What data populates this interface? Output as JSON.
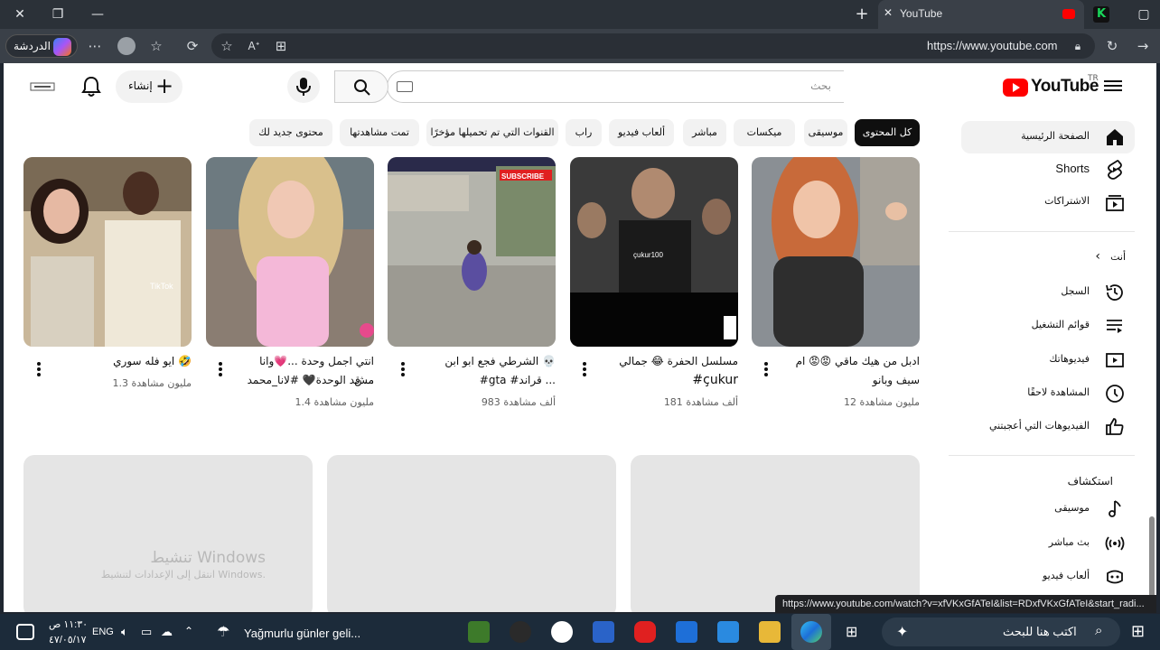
{
  "browser": {
    "tab_title": "YouTube",
    "url": "https://www.youtube.com",
    "chat_label": "الدردشة",
    "status_url": "https://www.youtube.com/watch?v=xfVKxGfATeI&list=RDxfVKxGfATeI&start_radi..."
  },
  "header": {
    "region": "TR",
    "logo_text": "YouTube",
    "search_placeholder": "بحث",
    "create_label": "إنشاء",
    "create_plus": "+"
  },
  "chips": [
    {
      "label": "كل المحتوى",
      "active": true
    },
    {
      "label": "موسيقى"
    },
    {
      "label": "ميكسات"
    },
    {
      "label": "مباشر"
    },
    {
      "label": "ألعاب فيديو"
    },
    {
      "label": "راب"
    },
    {
      "label": "القنوات التي تم تحميلها مؤخرًا"
    },
    {
      "label": "تمت مشاهدتها"
    },
    {
      "label": "محتوى جديد لك"
    }
  ],
  "sidebar": {
    "items_top": [
      {
        "label": "الصفحة الرئيسية",
        "icon": "home-icon"
      },
      {
        "label": "Shorts",
        "icon": "shorts-icon"
      },
      {
        "label": "الاشتراكات",
        "icon": "subscriptions-icon"
      }
    ],
    "you_heading": "أنت",
    "you_chevron": "‹",
    "items_you": [
      {
        "label": "السجل",
        "icon": "history-icon"
      },
      {
        "label": "قوائم التشغيل",
        "icon": "playlists-icon"
      },
      {
        "label": "فيديوهاتك",
        "icon": "your-videos-icon"
      },
      {
        "label": "المشاهدة لاحقًا",
        "icon": "watch-later-icon"
      },
      {
        "label": "الفيديوهات التي أعجبتني",
        "icon": "like-icon"
      }
    ],
    "explore_heading": "استكشاف",
    "items_explore": [
      {
        "label": "موسيقى",
        "icon": "music-icon"
      },
      {
        "label": "بث مباشر",
        "icon": "live-icon"
      },
      {
        "label": "ألعاب فيديو",
        "icon": "gaming-icon"
      }
    ]
  },
  "shorts": [
    {
      "title_l1": "ايو فله سوري 🤣",
      "title_l2": "",
      "views": "1.3 مليون مشاهدة"
    },
    {
      "title_l1": "انتي اجمل وحدة ...💗وانا مش",
      "title_l2": "قد الوحدة🖤 #لانا_محمد ...",
      "views": "1.4 مليون مشاهدة"
    },
    {
      "title_l1": "الشرطي فجع ابو ابن 💀",
      "title_l2": "#gta #قراند ...",
      "views": "983 ألف مشاهدة"
    },
    {
      "title_l1": "مسلسل الحفرة 😂 جمالي",
      "title_l2": "#çukur",
      "views": "181 ألف مشاهدة"
    },
    {
      "title_l1": "ادبل من هيك ماقي 😡😡 ام",
      "title_l2": "سيف وبانو",
      "views": "12 مليون مشاهدة"
    }
  ],
  "thumb_text": {
    "tiktok": "TikTok",
    "subscribe": "SUBSCRIBE",
    "cukur": "çukur100"
  },
  "watermark": {
    "title": "تنشيط Windows",
    "subtitle": "انتقل إلى الإعدادات لتنشيط Windows."
  },
  "taskbar": {
    "time": "١١:٣٠ ص",
    "date": "٤٧/٠٥/١٧",
    "lang": "ENG",
    "weather_text": "Yağmurlu günler geli...",
    "search_placeholder": "اكتب هنا للبحث"
  }
}
